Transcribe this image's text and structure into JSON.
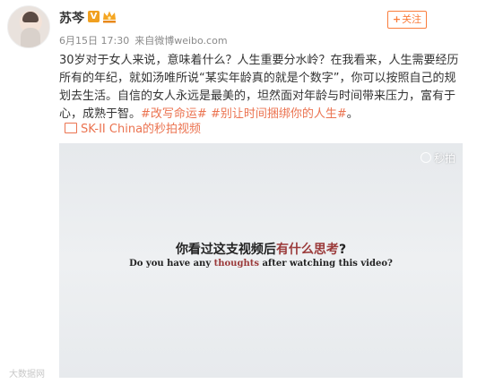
{
  "author": {
    "name": "苏芩",
    "vip_badge": "V"
  },
  "follow_label": "关注",
  "meta": {
    "date": "6月15日 17:30",
    "source_prefix": "来自",
    "source": "微博weibo.com"
  },
  "post": {
    "text1": "30岁对于女人来说，意味着什么？人生重要分水岭？在我看来，人生需要经历所有的年纪，就如汤唯所说“某实年龄真的就是个数字”，你可以按照自己的规划去生活。自信的女人永远是最美的，坦然面对年龄与时间带来压力，富有于心，成熟于智。",
    "topic1": "#改写命运#",
    "topic2": "#别让时间捆绑你的人生#",
    "end": "。"
  },
  "video_link": "SK-II China的秒拍视频",
  "video": {
    "watermark": "秒拍",
    "cn_prefix": "你看过这支视频后",
    "cn_highlight": "有什么思考",
    "cn_suffix": "?",
    "en_prefix": "Do you have any ",
    "en_highlight": "thoughts",
    "en_suffix": " after watching this video?"
  },
  "site_watermark": "大数据网",
  "colors": {
    "accent": "#eb7350",
    "follow": "#fa7d3c",
    "highlight": "#9b3a3a"
  }
}
